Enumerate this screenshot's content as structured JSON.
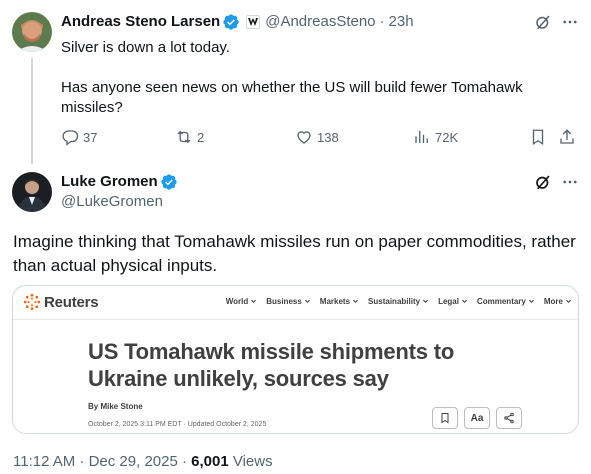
{
  "reply_tweet": {
    "display_name": "Andreas Steno Larsen",
    "handle": "@AndreasSteno",
    "separator": "·",
    "time": "23h",
    "text_line1": "Silver is down a lot today.",
    "text_line2": "Has anyone seen news on whether the US will build fewer Tomahawk missiles?",
    "replies": "37",
    "reposts": "2",
    "likes": "138",
    "views": "72K"
  },
  "main_tweet": {
    "display_name": "Luke Gromen",
    "handle": "@LukeGromen",
    "text": "Imagine thinking that Tomahawk missiles run on paper commodities, rather than actual physical inputs.",
    "timestamp": "11:12 AM · Dec 29, 2025 · ",
    "view_count": "6,001",
    "views_label": " Views"
  },
  "card": {
    "brand": "Reuters",
    "nav": [
      "World",
      "Business",
      "Markets",
      "Sustainability",
      "Legal",
      "Commentary",
      "More"
    ],
    "headline": "US Tomahawk missile shipments to Ukraine unlikely, sources say",
    "byline": "By Mike Stone",
    "dateline": "October 2, 2025 3:11 PM EDT · Updated October 2, 2025",
    "text_size_button": "Aa"
  },
  "colors": {
    "verified": "#1d9bf0",
    "muted": "#536471",
    "text": "#0f1419",
    "border": "#cfd9de"
  },
  "icons": [
    "verified-badge-icon",
    "affiliate-badge-icon",
    "grok-icon",
    "more-icon",
    "reply-icon",
    "repost-icon",
    "like-icon",
    "views-icon",
    "bookmark-icon",
    "share-icon",
    "reuters-logo-icon",
    "chevron-down-icon"
  ]
}
